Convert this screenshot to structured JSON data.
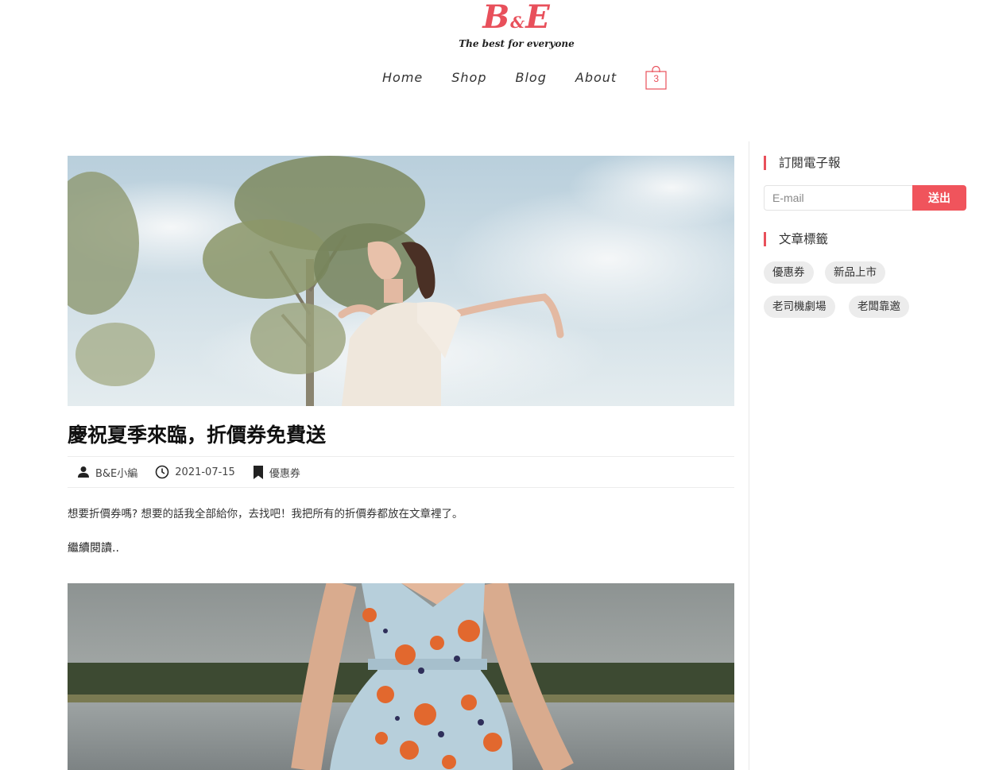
{
  "site": {
    "logo_b": "B",
    "logo_amp": "&",
    "logo_e": "E",
    "tagline": "The best for everyone",
    "brand_color": "#e8505b"
  },
  "nav": {
    "items": [
      {
        "label": "Home"
      },
      {
        "label": "Shop"
      },
      {
        "label": "Blog"
      },
      {
        "label": "About"
      }
    ],
    "cart_count": "3",
    "cart_icon": "shopping-bag-icon"
  },
  "post": {
    "title": "慶祝夏季來臨，折價券免費送",
    "author": "B&E小編",
    "date": "2021-07-15",
    "category": "優惠券",
    "excerpt": "想要折價券嗎? 想要的話我全部給你，去找吧！我把所有的折價券都放在文章裡了。",
    "read_more": "繼續閱讀.."
  },
  "sidebar": {
    "newsletter_title": "訂閱電子報",
    "email_placeholder": "E-mail",
    "submit_label": "送出",
    "tags_title": "文章標籤",
    "tags": [
      "優惠券",
      "新品上市",
      "老司機劇場",
      "老闆靠邀"
    ]
  }
}
